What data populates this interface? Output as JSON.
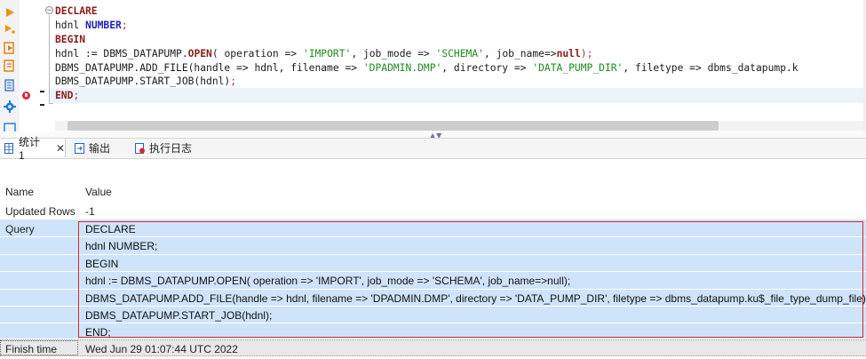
{
  "editor": {
    "lines": [
      [
        {
          "t": "DECLARE",
          "c": "kw"
        }
      ],
      [
        {
          "t": "hdnl ",
          "c": "ident"
        },
        {
          "t": "NUMBER",
          "c": "ty"
        },
        {
          "t": ";",
          "c": "semi"
        }
      ],
      [
        {
          "t": "BEGIN",
          "c": "kw"
        }
      ],
      [
        {
          "t": "hdnl := DBMS_DATAPUMP.",
          "c": "ident"
        },
        {
          "t": "OPEN",
          "c": "kw"
        },
        {
          "t": "( operation => ",
          "c": "ident"
        },
        {
          "t": "'IMPORT'",
          "c": "st"
        },
        {
          "t": ", job_mode => ",
          "c": "ident"
        },
        {
          "t": "'SCHEMA'",
          "c": "st"
        },
        {
          "t": ", job_name=>",
          "c": "ident"
        },
        {
          "t": "null",
          "c": "kw"
        },
        {
          "t": ");",
          "c": "semi"
        }
      ],
      [
        {
          "t": "DBMS_DATAPUMP.ADD_FILE(handle => hdnl, filename => ",
          "c": "ident"
        },
        {
          "t": "'DPADMIN.DMP'",
          "c": "st"
        },
        {
          "t": ", directory => ",
          "c": "ident"
        },
        {
          "t": "'DATA_PUMP_DIR'",
          "c": "st"
        },
        {
          "t": ", filetype => dbms_datapump.k",
          "c": "ident"
        }
      ],
      [
        {
          "t": "DBMS_DATAPUMP.START_JOB(hdnl)",
          "c": "ident"
        },
        {
          "t": ";",
          "c": "semi"
        }
      ],
      [
        {
          "t": "END",
          "c": "kw"
        },
        {
          "t": ";",
          "c": "semi"
        }
      ]
    ]
  },
  "tabs": [
    {
      "label": "统计 1",
      "close": "✕"
    },
    {
      "label": "输出"
    },
    {
      "label": "执行日志"
    }
  ],
  "grid": {
    "header": {
      "name": "Name",
      "value": "Value"
    },
    "updated_rows": {
      "name": "Updated Rows",
      "value": "-1"
    },
    "query": {
      "name": "Query",
      "lines": [
        "DECLARE",
        "hdnl NUMBER;",
        "BEGIN",
        "hdnl := DBMS_DATAPUMP.OPEN( operation => 'IMPORT', job_mode => 'SCHEMA', job_name=>null);",
        "DBMS_DATAPUMP.ADD_FILE(handle => hdnl, filename => 'DPADMIN.DMP', directory => 'DATA_PUMP_DIR', filetype => dbms_datapump.ku$_file_type_dump_file);",
        "DBMS_DATAPUMP.START_JOB(hdnl);",
        "END;"
      ]
    },
    "finish_time": {
      "name": "Finish time",
      "value": "Wed Jun 29 01:07:44 UTC 2022"
    }
  },
  "colors": {
    "keyword": "#8b1a1a",
    "type": "#1f1fb0",
    "string": "#1e8b1e",
    "selection": "#cfe4fb",
    "highlight_border": "#d9262e"
  }
}
